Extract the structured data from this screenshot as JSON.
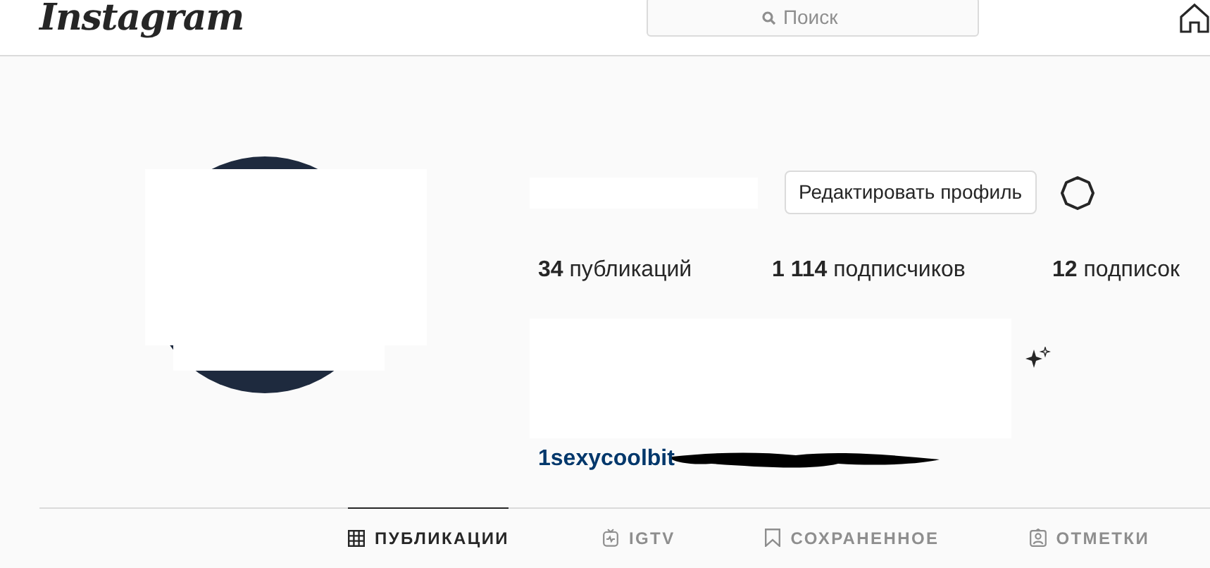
{
  "header": {
    "logo": "Instagram",
    "search": {
      "placeholder": "Поиск"
    }
  },
  "profile": {
    "edit_button": "Редактировать профиль",
    "stats": [
      {
        "count": "34",
        "label": "публикаций"
      },
      {
        "count": "1 114",
        "label": "подписчиков"
      },
      {
        "count": "12",
        "label": "подписок"
      }
    ],
    "link": "1sexycoolbit"
  },
  "tabs": [
    {
      "label": "ПУБЛИКАЦИИ",
      "kind": "grid",
      "selected": true
    },
    {
      "label": "IGTV",
      "kind": "tv",
      "selected": false
    },
    {
      "label": "СОХРАНЕННОЕ",
      "kind": "bookmark",
      "selected": false
    },
    {
      "label": "ОТМЕТКИ",
      "kind": "tag",
      "selected": false
    }
  ]
}
